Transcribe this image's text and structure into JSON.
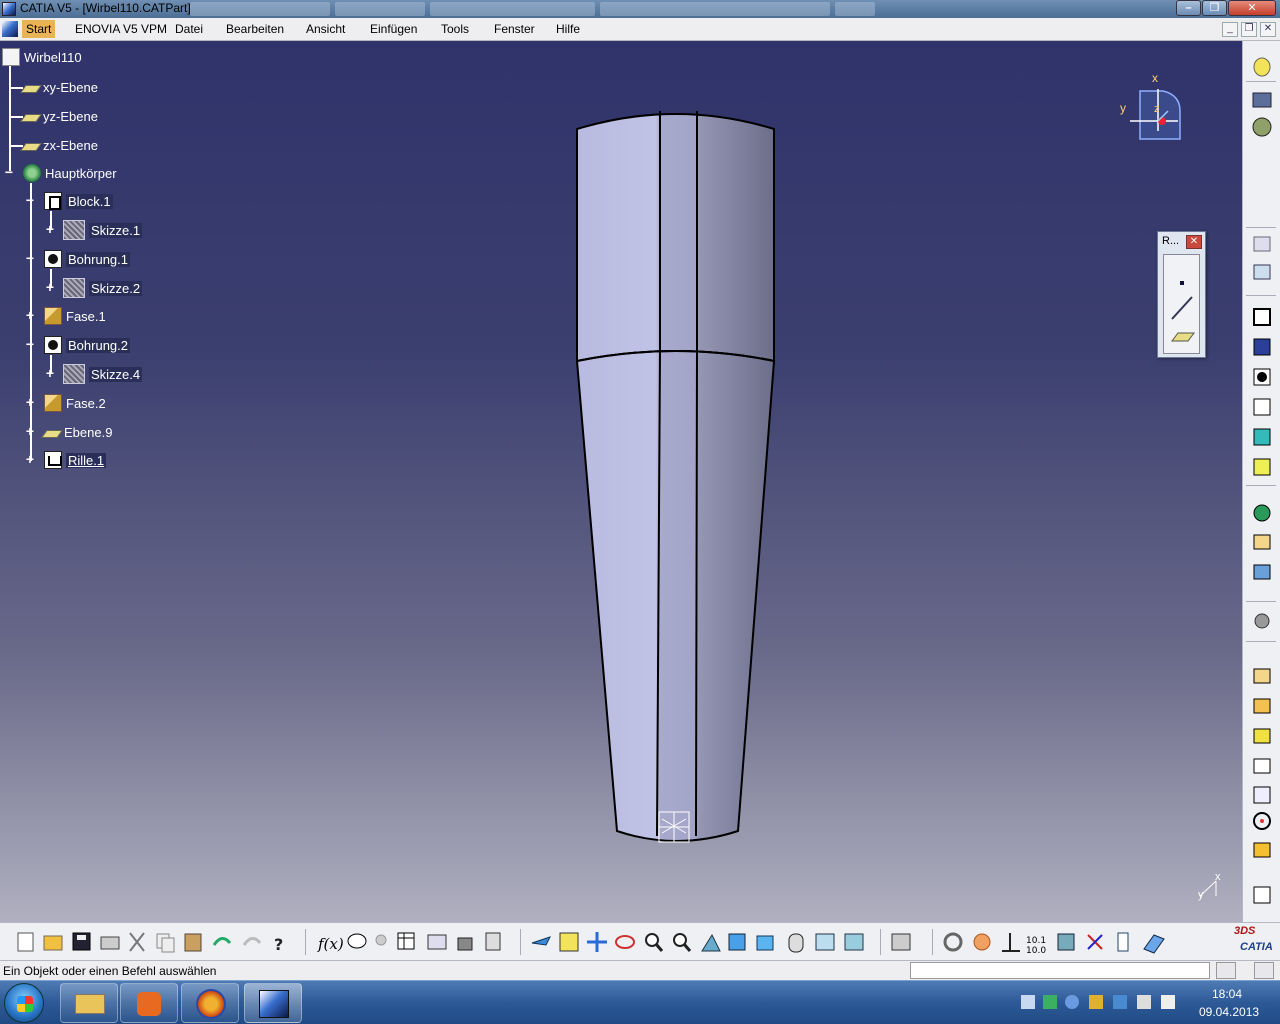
{
  "window": {
    "title": "CATIA V5 - [Wirbel110.CATPart]",
    "minimize": "–",
    "maximize": "❐",
    "close": "✕"
  },
  "menu": {
    "items": [
      "Start",
      "ENOVIA V5 VPM",
      "Datei",
      "Bearbeiten",
      "Ansicht",
      "Einfügen",
      "Tools",
      "Fenster",
      "Hilfe"
    ]
  },
  "tree": {
    "root": "Wirbel110",
    "planes": [
      "xy-Ebene",
      "yz-Ebene",
      "zx-Ebene"
    ],
    "body": "Hauptkörper",
    "features": [
      {
        "label": "Block.1",
        "child": "Skizze.1"
      },
      {
        "label": "Bohrung.1",
        "child": "Skizze.2"
      },
      {
        "label": "Fase.1"
      },
      {
        "label": "Bohrung.2",
        "child": "Skizze.4"
      },
      {
        "label": "Fase.2"
      },
      {
        "label": "Ebene.9"
      },
      {
        "label": "Rille.1"
      }
    ]
  },
  "compass": {
    "x": "x",
    "y": "y",
    "z": "z"
  },
  "axis_indicator": {
    "x": "x",
    "y": "y"
  },
  "floating_toolbar": {
    "title": "R...",
    "close": "✕"
  },
  "status": {
    "text": "Ein Objekt oder einen Befehl auswählen"
  },
  "catia_logo": {
    "brand": "CATIA",
    "mark": "3DS"
  },
  "clock": {
    "time": "18:04",
    "date": "09.04.2013"
  },
  "colors": {
    "viewport_top": "#30336a",
    "viewport_bottom": "#b0b0c0",
    "part_light": "#b9bbe0",
    "part_dark": "#6a6c8a",
    "start_highlight": "#e8b455"
  }
}
